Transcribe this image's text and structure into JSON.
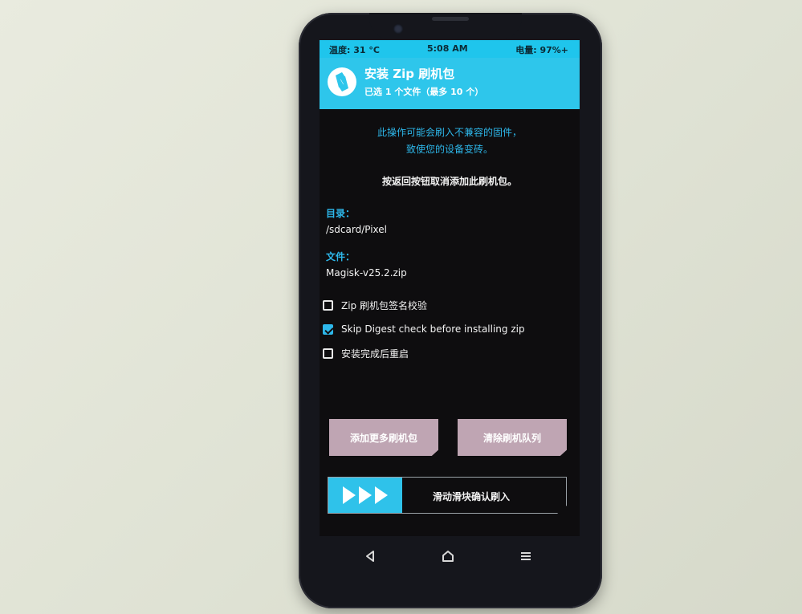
{
  "status_bar": {
    "temperature": "温度: 31 °C",
    "time": "5:08 AM",
    "battery": "电量: 97%+"
  },
  "header": {
    "title": "安装 Zip 刷机包",
    "subtitle": "已选 1 个文件（最多 10 个）"
  },
  "warning": {
    "line1": "此操作可能会刷入不兼容的固件，",
    "line2": "致使您的设备变砖。"
  },
  "back_note": "按返回按钮取消添加此刷机包。",
  "directory": {
    "label": "目录：",
    "value": "/sdcard/Pixel"
  },
  "file": {
    "label": "文件：",
    "value": "Magisk-v25.2.zip"
  },
  "options": [
    {
      "label": "Zip 刷机包签名校验",
      "checked": false
    },
    {
      "label": "Skip Digest check before installing zip",
      "checked": true
    },
    {
      "label": "安装完成后重启",
      "checked": false
    }
  ],
  "buttons": {
    "add_more": "添加更多刷机包",
    "clear_queue": "清除刷机队列"
  },
  "slider": {
    "text": "滑动滑块确认刷入"
  },
  "icons": {
    "logo": "twrp-logo-icon",
    "back": "back-triangle-icon",
    "home": "home-icon",
    "menu": "menu-lines-icon"
  },
  "colors": {
    "accent": "#2ec6eb",
    "button": "#bfa5b3",
    "screen_bg": "#0e0d0f"
  }
}
